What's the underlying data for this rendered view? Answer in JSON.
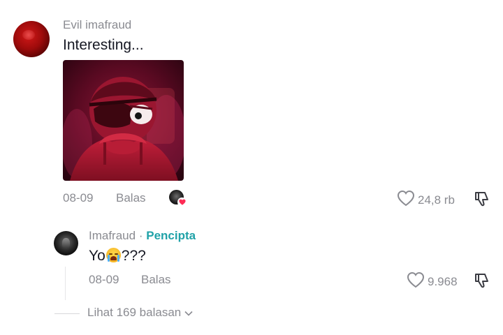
{
  "comment": {
    "username": "Evil imafraud",
    "text": "Interesting...",
    "date": "08-09",
    "reply_label": "Balas",
    "likes": "24,8 rb",
    "liked_by_creator": true
  },
  "reply": {
    "username": "Imafraud",
    "separator": "·",
    "creator_badge": "Pencipta",
    "text_before_emoji": "Yo",
    "emoji": "loudly-crying-face",
    "text_after_emoji": "???",
    "date": "08-09",
    "reply_label": "Balas",
    "likes": "9.968"
  },
  "view_replies": {
    "label": "Lihat 169 balasan"
  },
  "colors": {
    "muted_text": "#8a8b91",
    "creator_badge": "#20a2a8",
    "liked_heart": "#fe2c55",
    "primary_text": "#161823"
  }
}
